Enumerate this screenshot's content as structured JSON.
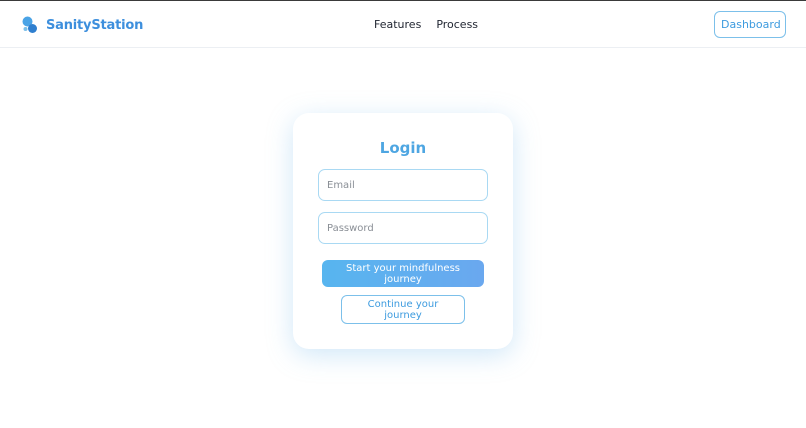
{
  "header": {
    "brand_name": "SanityStation",
    "brand_icon": "bubbles-icon",
    "nav": [
      {
        "label": "Features"
      },
      {
        "label": "Process"
      }
    ],
    "dashboard_label": "Dashboard"
  },
  "login": {
    "title": "Login",
    "email_placeholder": "Email",
    "email_value": "",
    "password_placeholder": "Password",
    "password_value": "",
    "primary_label": "Start your mindfulness journey",
    "secondary_label": "Continue your journey"
  },
  "colors": {
    "brand": "#3d8fdd",
    "accent": "#4ea6e2",
    "button_gradient_start": "#57b5ef",
    "button_gradient_end": "#6aa8ef",
    "input_border": "#a9d9f3"
  }
}
